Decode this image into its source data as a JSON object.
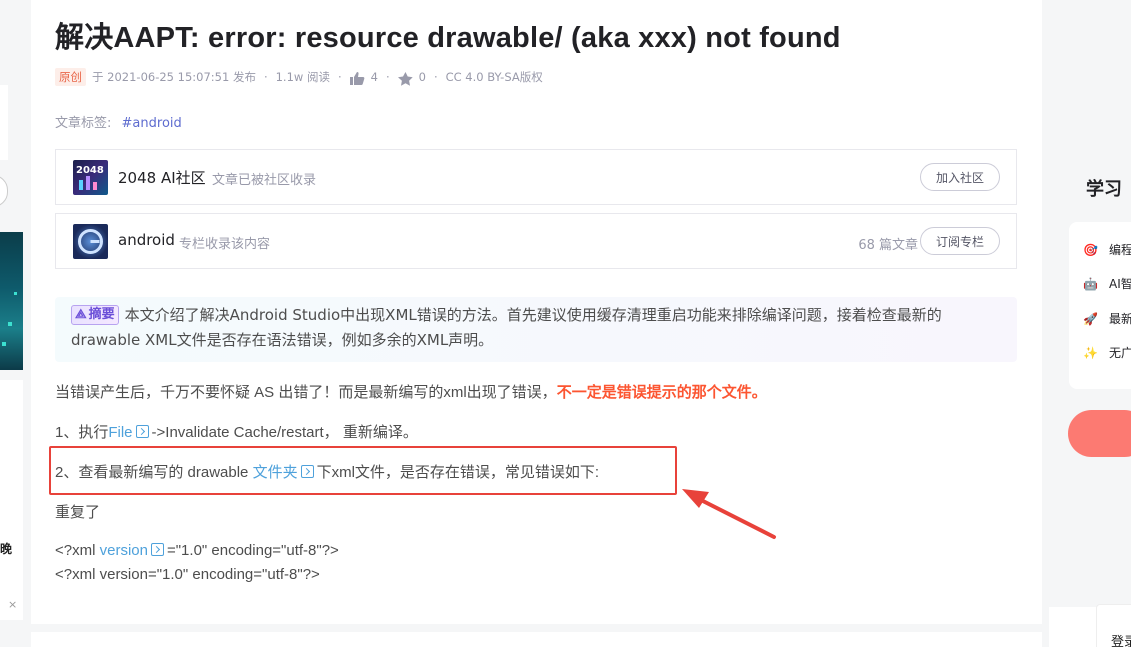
{
  "article": {
    "title": "解决AAPT: error: resource drawable/ (aka xxx) not found",
    "meta": {
      "badge": "原创",
      "publish": "于 2021-06-25 15:07:51 发布",
      "views": "1.1w 阅读",
      "likes": "4",
      "collects": "0",
      "license": "CC 4.0 BY-SA版权"
    },
    "tags_label": "文章标签:",
    "tags": [
      "#android"
    ],
    "community": {
      "name": "2048 AI社区",
      "desc": "文章已被社区收录",
      "button": "加入社区"
    },
    "column": {
      "name": "android",
      "desc": "专栏收录该内容",
      "count": "68 篇文章",
      "button": "订阅专栏"
    },
    "summary": {
      "badge": "摘要",
      "text": "本文介绍了解决Android Studio中出现XML错误的方法。首先建议使用缓存清理重启功能来排除编译问题，接着检查最新的drawable XML文件是否存在语法错误，例如多余的XML声明。"
    },
    "body": {
      "p1_normal": "当错误产生后，千万不要怀疑 AS 出错了！而是最新编写的xml出现了错误，",
      "p1_red": "不一定是错误提示的那个文件。",
      "p2_prefix": "1、执行",
      "p2_link": "File",
      "p2_suffix": "->Invalidate Cache/restart， 重新编译。",
      "p3_prefix": "2、查看最新编写的 drawable ",
      "p3_link": "文件夹",
      "p3_suffix": "下xml文件，是否存在错误，常见错误如下:",
      "p4": "重复了",
      "code1_prefix": "<?xml ",
      "code1_link": "version",
      "code1_suffix": "=\"1.0\" encoding=\"utf-8\"?>",
      "code2": "<?xml version=\"1.0\" encoding=\"utf-8\"?>"
    }
  },
  "right_sidebar": {
    "heading": "学习",
    "items": [
      "编程",
      "AI智",
      "最新",
      "无广"
    ],
    "login": "登录"
  },
  "left_sidebar": {
    "partial_text": "晚",
    "close": "×"
  },
  "colors": {
    "accent_red": "#fc5531",
    "link_blue": "#4ea1db",
    "tag_blue": "#5e6ccf",
    "annotation_red": "#e8423a"
  }
}
